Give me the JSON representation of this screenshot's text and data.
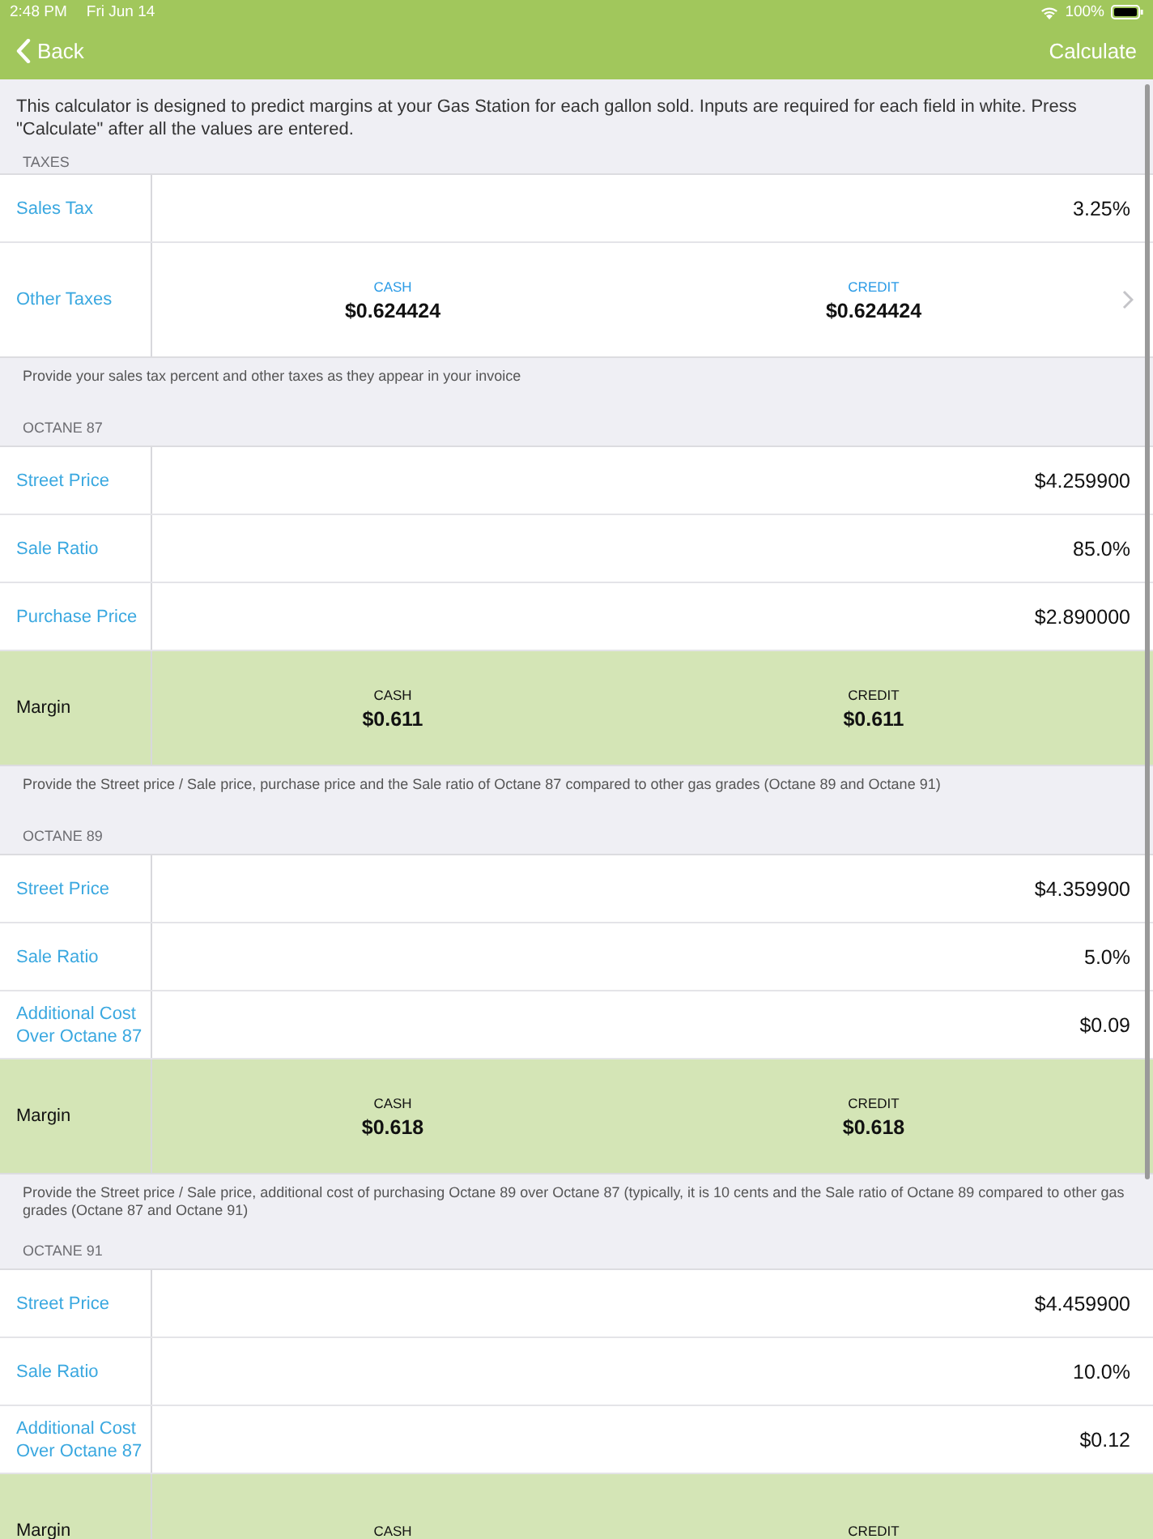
{
  "status_bar": {
    "time": "2:48 PM",
    "date": "Fri Jun 14",
    "battery": "100%"
  },
  "nav_bar": {
    "back": "Back",
    "action": "Calculate"
  },
  "intro": "This calculator is designed to predict margins at your Gas Station for each gallon sold. Inputs are required for each field in white. Press \"Calculate\" after all the values are entered.",
  "sections": [
    {
      "header": "TAXES",
      "rows": [
        {
          "kind": "input",
          "label": "Sales Tax",
          "value": "3.25%"
        },
        {
          "kind": "split",
          "label": "Other Taxes",
          "cash_label": "CASH",
          "cash": "$0.624424",
          "credit_label": "CREDIT",
          "credit": "$0.624424"
        }
      ],
      "footer": "Provide your sales tax percent and other taxes as they appear in your invoice"
    },
    {
      "header": "OCTANE 87",
      "rows": [
        {
          "kind": "input",
          "label": "Street Price",
          "value": "$4.259900"
        },
        {
          "kind": "input",
          "label": "Sale Ratio",
          "value": "85.0%"
        },
        {
          "kind": "input",
          "label": "Purchase Price",
          "value": "$2.890000"
        },
        {
          "kind": "margin",
          "label": "Margin",
          "cash_label": "CASH",
          "cash": "$0.611",
          "credit_label": "CREDIT",
          "credit": "$0.611"
        }
      ],
      "footer": "Provide the Street price / Sale price, purchase price and the Sale ratio of Octane 87 compared to other gas grades (Octane 89 and Octane 91)"
    },
    {
      "header": "OCTANE 89",
      "rows": [
        {
          "kind": "input",
          "label": "Street Price",
          "value": "$4.359900"
        },
        {
          "kind": "input",
          "label": "Sale Ratio",
          "value": "5.0%"
        },
        {
          "kind": "input",
          "label": "Additional Cost Over Octane 87",
          "value": "$0.09"
        },
        {
          "kind": "margin",
          "label": "Margin",
          "cash_label": "CASH",
          "cash": "$0.618",
          "credit_label": "CREDIT",
          "credit": "$0.618"
        }
      ],
      "footer": "Provide the Street price / Sale price, additional cost of purchasing Octane 89 over Octane 87 (typically, it is 10 cents and the Sale ratio of Octane 89 compared to other gas grades (Octane 87 and Octane 91)"
    },
    {
      "header": "OCTANE 91",
      "rows": [
        {
          "kind": "input",
          "label": "Street Price",
          "value": "$4.459900"
        },
        {
          "kind": "input",
          "label": "Sale Ratio",
          "value": "10.0%"
        },
        {
          "kind": "input",
          "label": "Additional Cost Over Octane 87",
          "value": "$0.12"
        },
        {
          "kind": "margin",
          "label": "Margin",
          "cash_label": "CASH",
          "credit_label": "CREDIT"
        }
      ]
    }
  ]
}
